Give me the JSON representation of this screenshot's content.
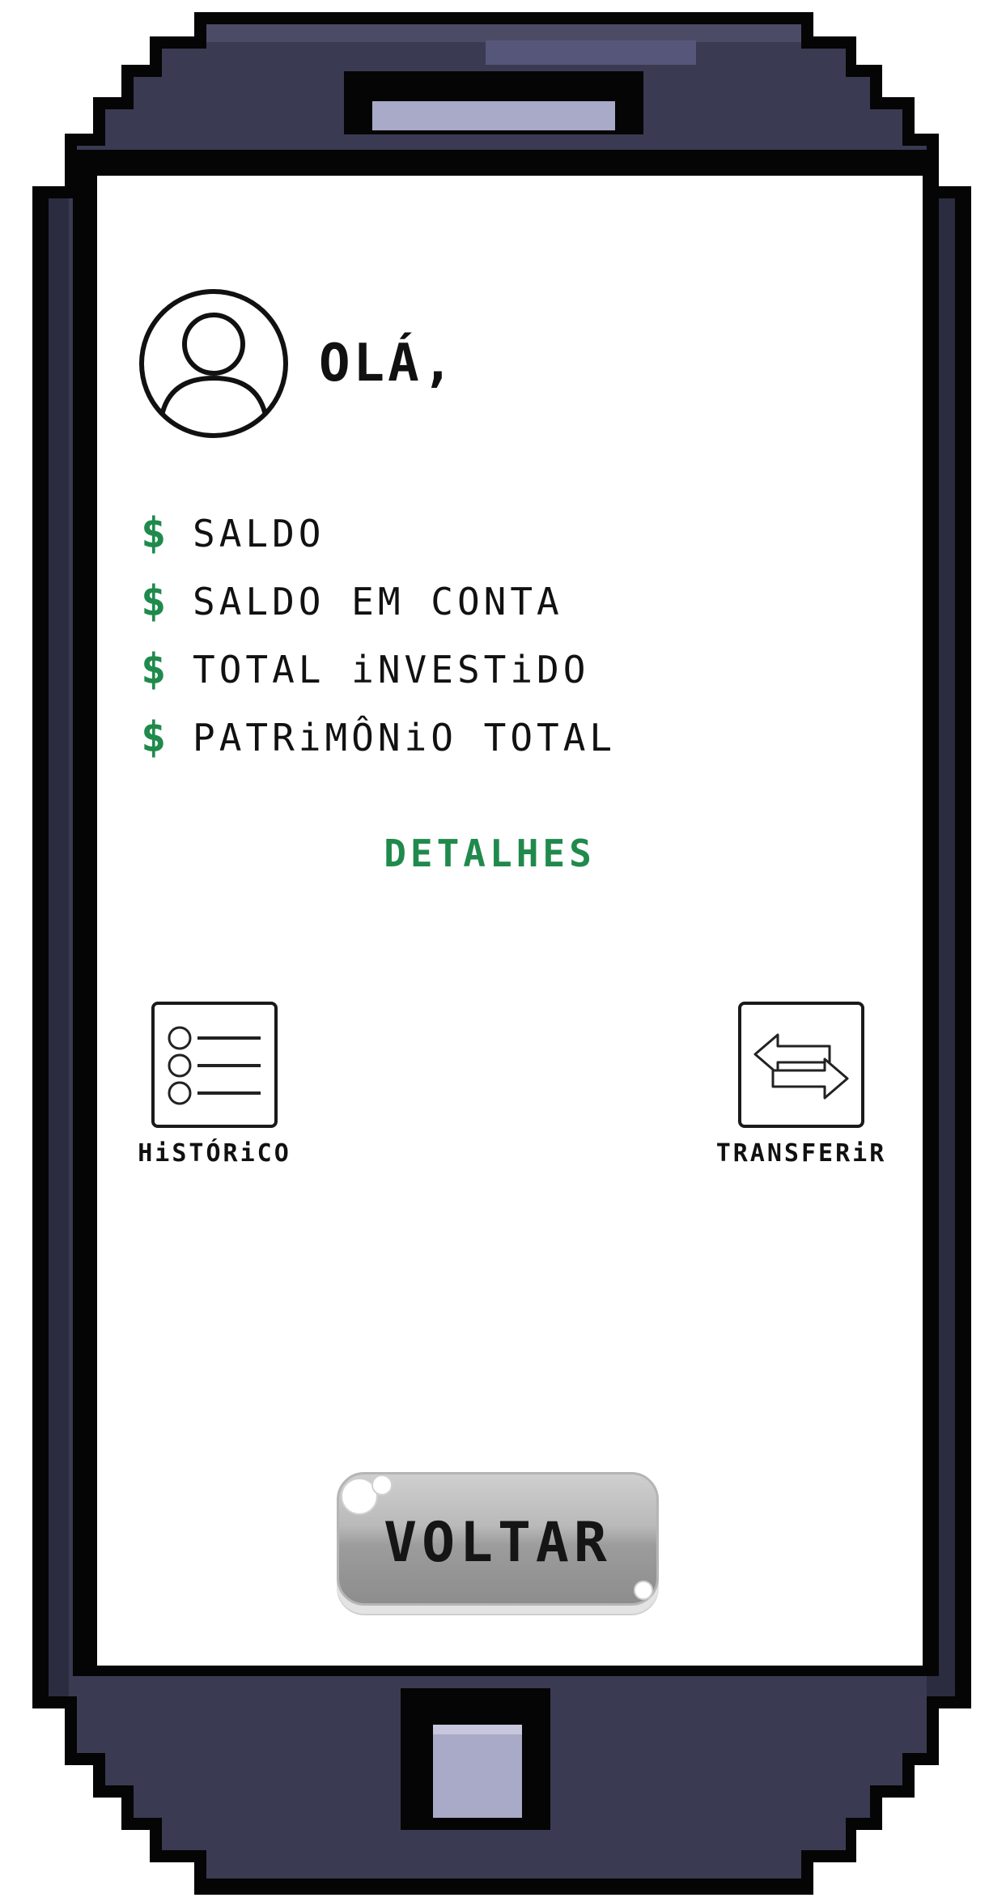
{
  "greeting": {
    "text": "OLÁ,"
  },
  "balances": [
    {
      "symbol": "$",
      "label": "SALDO"
    },
    {
      "symbol": "$",
      "label": "SALDO EM CONTA"
    },
    {
      "symbol": "$",
      "label": "TOTAL iNVESTiDO"
    },
    {
      "symbol": "$",
      "label": "PATRiMÔNiO TOTAL"
    }
  ],
  "details": {
    "label": "DETALHES"
  },
  "actions": {
    "history": {
      "label": "HiSTÓRiCO",
      "icon": "list-icon"
    },
    "transfer": {
      "label": "TRANSFERiR",
      "icon": "transfer-arrows-icon"
    }
  },
  "back_button": {
    "label": "VOLTAR"
  },
  "colors": {
    "accent_green": "#1f8a4c",
    "phone_body": "#3a3a52",
    "phone_outline": "#050505",
    "speaker": "#a9a9c8"
  }
}
